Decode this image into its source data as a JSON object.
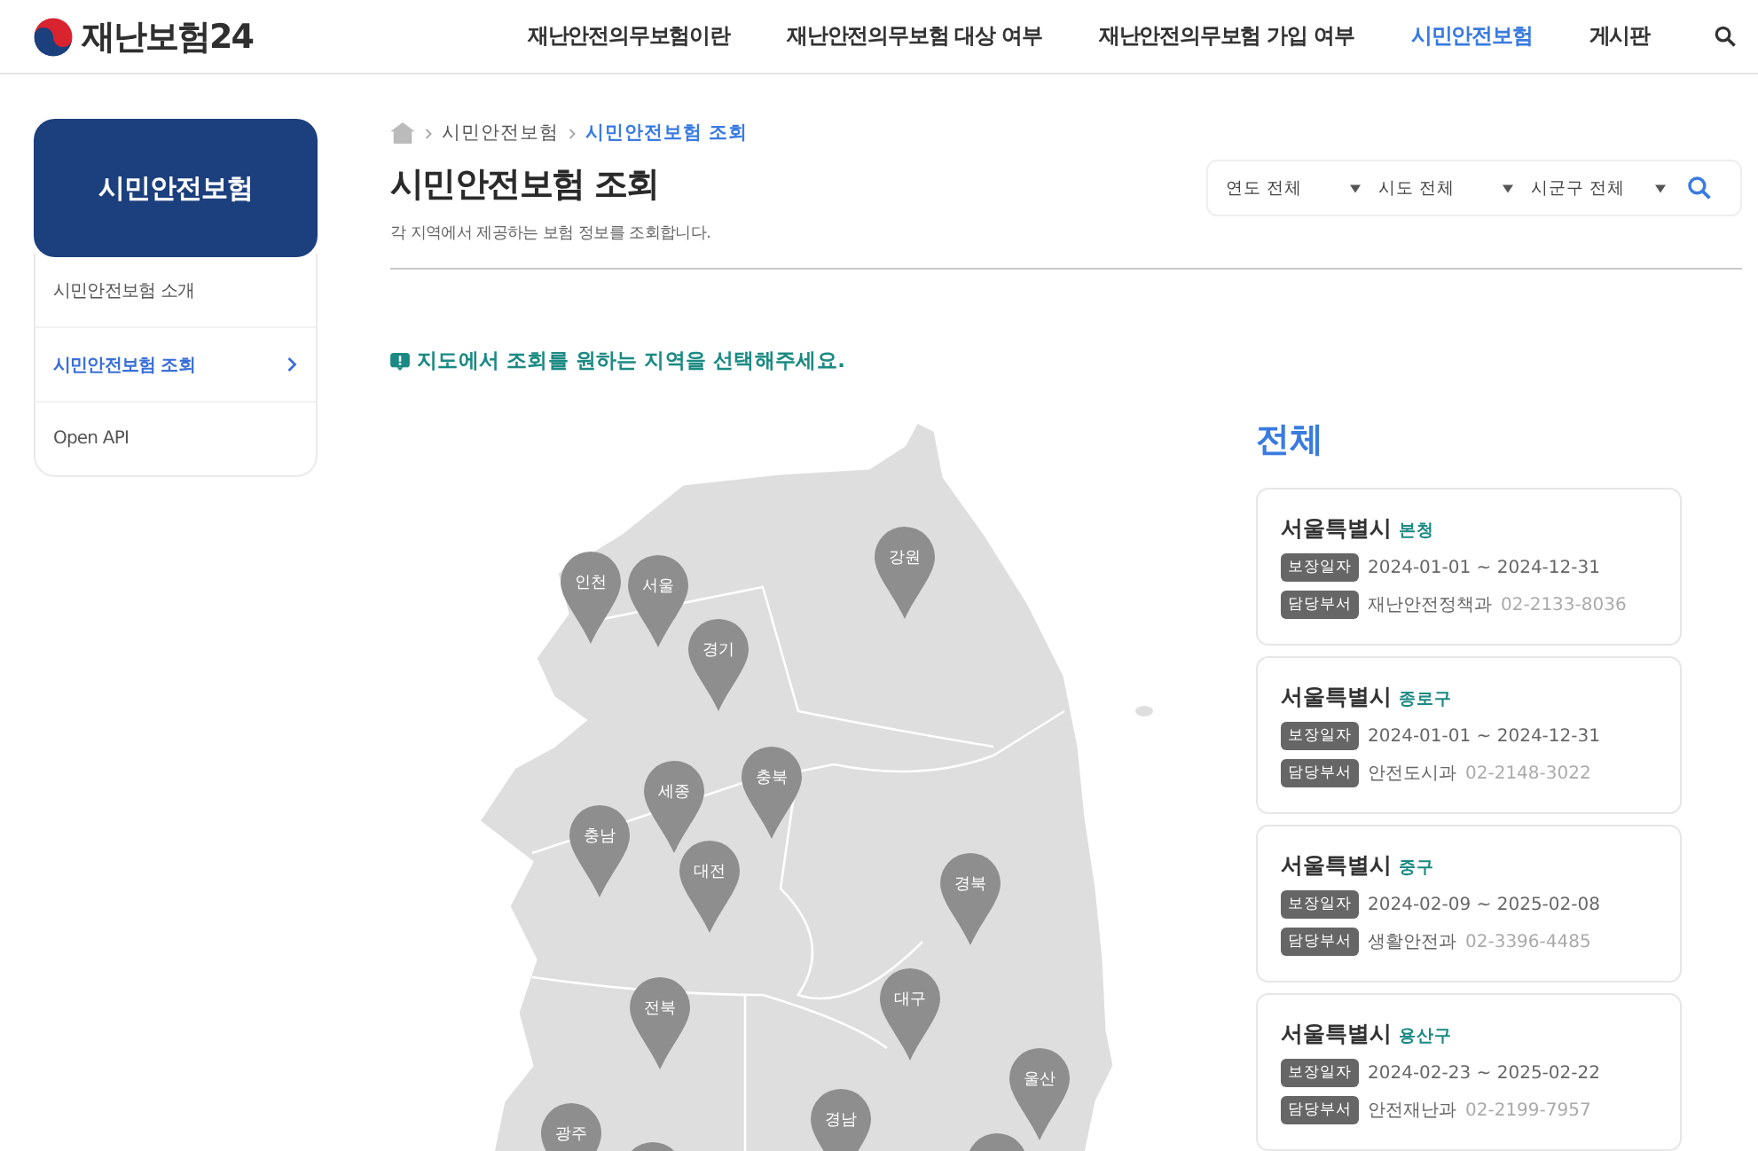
{
  "logo": {
    "text": "재난보험24"
  },
  "nav": [
    {
      "label": "재난안전의무보험이란",
      "selected": false
    },
    {
      "label": "재난안전의무보험 대상 여부",
      "selected": false
    },
    {
      "label": "재난안전의무보험 가입 여부",
      "selected": false
    },
    {
      "label": "시민안전보험",
      "selected": true
    },
    {
      "label": "게시판",
      "selected": false
    }
  ],
  "sidebar": {
    "title": "시민안전보험",
    "items": [
      {
        "label": "시민안전보험 소개",
        "selected": false
      },
      {
        "label": "시민안전보험 조회",
        "selected": true
      },
      {
        "label": "Open API",
        "selected": false
      }
    ]
  },
  "breadcrumb": [
    {
      "label": "시민안전보험",
      "selected": false
    },
    {
      "label": "시민안전보험 조회",
      "selected": true
    }
  ],
  "page_title": "시민안전보험 조회",
  "page_subtitle": "각 지역에서 제공하는 보험 정보를 조회합니다.",
  "filters": [
    {
      "value": "연도 전체"
    },
    {
      "value": "시도 전체"
    },
    {
      "value": "시군구 전체"
    }
  ],
  "notice": "지도에서 조회를 원하는 지역을 선택해주세요.",
  "map_pins": [
    {
      "label": "인천"
    },
    {
      "label": "서울"
    },
    {
      "label": "경기"
    },
    {
      "label": "강원"
    },
    {
      "label": "세종"
    },
    {
      "label": "충북"
    },
    {
      "label": "충남"
    },
    {
      "label": "대전"
    },
    {
      "label": "경북"
    },
    {
      "label": "전북"
    },
    {
      "label": "대구"
    },
    {
      "label": "울산"
    },
    {
      "label": "경남"
    },
    {
      "label": "광주"
    }
  ],
  "results": {
    "heading": "전체",
    "cards": [
      {
        "city": "서울특별시",
        "district": "본청",
        "period_label": "보장일자",
        "period": "2024-01-01 ~ 2024-12-31",
        "dept_label": "담당부서",
        "dept": "재난안전정책과",
        "phone": "02-2133-8036"
      },
      {
        "city": "서울특별시",
        "district": "종로구",
        "period_label": "보장일자",
        "period": "2024-01-01 ~ 2024-12-31",
        "dept_label": "담당부서",
        "dept": "안전도시과",
        "phone": "02-2148-3022"
      },
      {
        "city": "서울특별시",
        "district": "중구",
        "period_label": "보장일자",
        "period": "2024-02-09 ~ 2025-02-08",
        "dept_label": "담당부서",
        "dept": "생활안전과",
        "phone": "02-3396-4485"
      },
      {
        "city": "서울특별시",
        "district": "용산구",
        "period_label": "보장일자",
        "period": "2024-02-23 ~ 2025-02-22",
        "dept_label": "담당부서",
        "dept": "안전재난과",
        "phone": "02-2199-7957"
      }
    ]
  }
}
